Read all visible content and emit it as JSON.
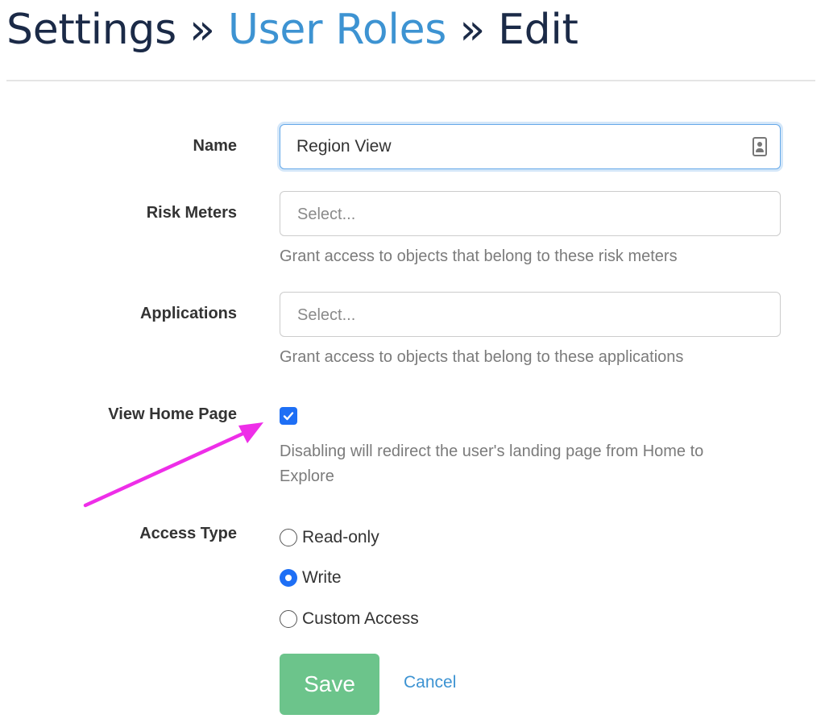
{
  "breadcrumb": {
    "root": "Settings",
    "separator": "»",
    "section": "User Roles",
    "current": "Edit"
  },
  "form": {
    "name": {
      "label": "Name",
      "value": "Region View",
      "icon": "contact-card-icon"
    },
    "risk_meters": {
      "label": "Risk Meters",
      "placeholder": "Select...",
      "help": "Grant access to objects that belong to these risk meters"
    },
    "applications": {
      "label": "Applications",
      "placeholder": "Select...",
      "help": "Grant access to objects that belong to these applications"
    },
    "view_home_page": {
      "label": "View Home Page",
      "checked": true,
      "help_line1": "Disabling will redirect the user's landing page from Home to",
      "help_line2": "Explore"
    },
    "access_type": {
      "label": "Access Type",
      "options": [
        {
          "label": "Read-only",
          "selected": false
        },
        {
          "label": "Write",
          "selected": true
        },
        {
          "label": "Custom Access",
          "selected": false
        }
      ]
    }
  },
  "actions": {
    "save_label": "Save",
    "cancel_label": "Cancel"
  },
  "colors": {
    "title": "#1b2a47",
    "link": "#3d93d2",
    "accent": "#1e6ff5",
    "save_button": "#6cc48b",
    "annotation_arrow": "#ee2ee8"
  }
}
